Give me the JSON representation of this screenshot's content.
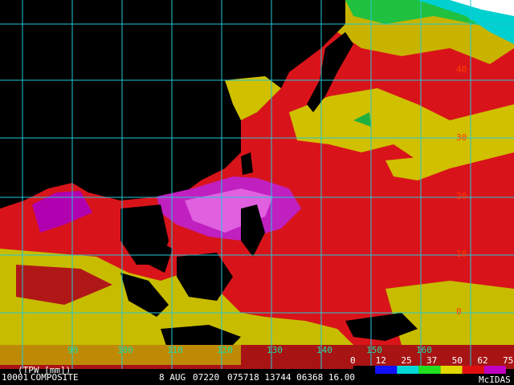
{
  "map": {
    "colors": {
      "background": "#000000",
      "grid": "#22c8d8",
      "coast": "#ffff00",
      "lat_label": "#ff3c00",
      "lon_label": "#1fe0a0",
      "bar_text": "#ffffff"
    },
    "lon_labels": [
      "90",
      "100",
      "110",
      "120",
      "130",
      "140",
      "150",
      "160"
    ],
    "lat_labels": [
      "40",
      "30",
      "20",
      "10",
      "0"
    ]
  },
  "status_bar": {
    "product": "(TPW [mm])",
    "image_id": "10001",
    "type": "COMPOSITE",
    "date": "8 AUG",
    "time": "07220",
    "frame_info": "075718  13744  06368  16.00",
    "credit": "McIDAS"
  },
  "legend": {
    "ticks": [
      "0",
      "12",
      "25",
      "37",
      "50",
      "62",
      "75"
    ],
    "colors": [
      "#000000",
      "#1010ff",
      "#00d8d8",
      "#20e020",
      "#e0d800",
      "#e01010",
      "#c000c0"
    ]
  }
}
